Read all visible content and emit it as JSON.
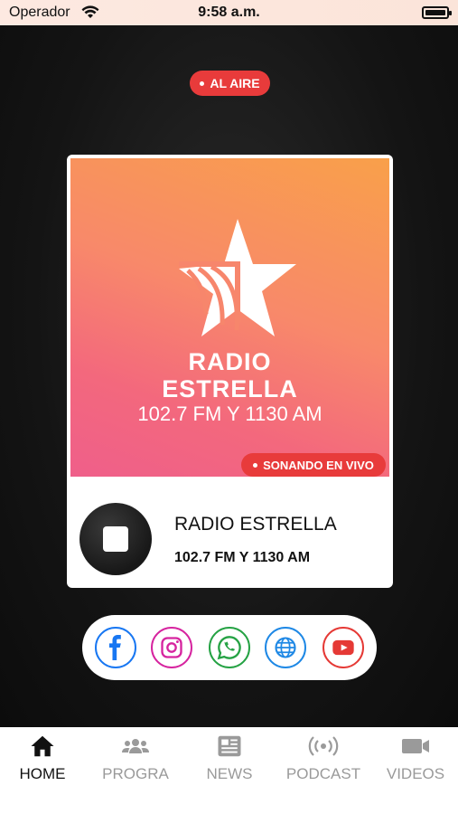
{
  "status_bar": {
    "carrier": "Operador",
    "time": "9:58 a.m."
  },
  "on_air_badge": "AL AIRE",
  "cover": {
    "brand_line1": "RADIO",
    "brand_line2": "ESTRELLA",
    "brand_line3": "102.7 FM Y 1130 AM",
    "live_badge": "SONANDO EN VIVO"
  },
  "player": {
    "station_name": "RADIO ESTRELLA",
    "station_freq": "102.7 FM Y 1130 AM",
    "state_icon": "stop-icon"
  },
  "social": [
    {
      "icon": "facebook-icon",
      "color": "#1877f2"
    },
    {
      "icon": "instagram-icon",
      "color": "#d6249f"
    },
    {
      "icon": "whatsapp-icon",
      "color": "#25a244"
    },
    {
      "icon": "globe-icon",
      "color": "#1e88e5"
    },
    {
      "icon": "youtube-icon",
      "color": "#e53935"
    }
  ],
  "tabs": [
    {
      "label": "HOME",
      "icon": "home-icon",
      "active": true
    },
    {
      "label": "PROGRA",
      "icon": "users-icon",
      "active": false
    },
    {
      "label": "NEWS",
      "icon": "newspaper-icon",
      "active": false
    },
    {
      "label": "PODCAST",
      "icon": "broadcast-icon",
      "active": false
    },
    {
      "label": "VIDEOS",
      "icon": "video-camera-icon",
      "active": false
    }
  ],
  "colors": {
    "accent": "#e83b3b",
    "background": "#111111"
  }
}
